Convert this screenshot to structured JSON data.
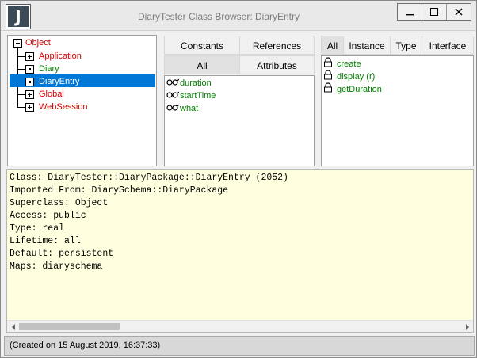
{
  "window": {
    "title": "DiaryTester Class Browser: DiaryEntry",
    "app_icon_letter": "J"
  },
  "tree": {
    "root": "Object",
    "children": [
      {
        "label": "Application",
        "color": "#d40000",
        "expander": "plus"
      },
      {
        "label": "Diary",
        "color": "#008000",
        "expander": "dot"
      },
      {
        "label": "DiaryEntry",
        "color": "#ffffff",
        "expander": "dot",
        "selected": true
      },
      {
        "label": "Global",
        "color": "#d40000",
        "expander": "plus"
      },
      {
        "label": "WebSession",
        "color": "#d40000",
        "expander": "plus"
      }
    ]
  },
  "member_tabs": {
    "row1": [
      "Constants",
      "References"
    ],
    "row2": [
      "All",
      "Attributes"
    ],
    "active": "All"
  },
  "attributes": [
    {
      "label": "duration",
      "icon": "glasses-icon"
    },
    {
      "label": "startTime",
      "icon": "glasses-icon"
    },
    {
      "label": "what",
      "icon": "glasses-icon"
    }
  ],
  "method_tabs": {
    "items": [
      "All",
      "Instance",
      "Type",
      "Interface"
    ],
    "active": "All"
  },
  "methods": [
    {
      "label": "create",
      "icon": "lock-icon"
    },
    {
      "label": "display (r)",
      "icon": "lock-icon"
    },
    {
      "label": "getDuration",
      "icon": "lock-icon"
    }
  ],
  "info": {
    "lines": [
      "Class: DiaryTester::DiaryPackage::DiaryEntry (2052)",
      "Imported From: DiarySchema::DiaryPackage",
      "Superclass: Object",
      "Access: public",
      "Type: real",
      "Lifetime: all",
      "Default: persistent",
      "Maps: diaryschema"
    ]
  },
  "status": {
    "text": "(Created on 15 August 2019, 16:37:33)"
  },
  "colors": {
    "selection": "#0078d7",
    "info_background": "#ffffe0",
    "member_green": "#008000",
    "class_red": "#d40000"
  }
}
